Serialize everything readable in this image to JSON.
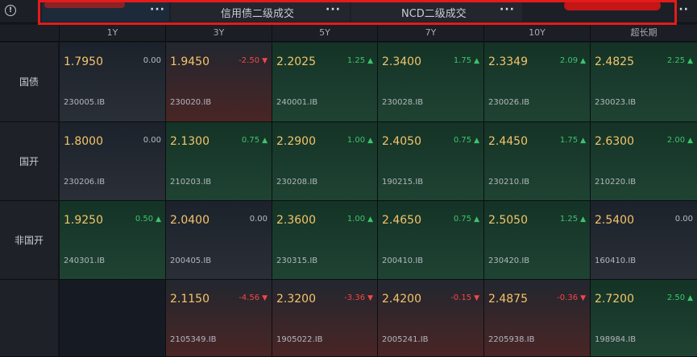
{
  "toolbar": {
    "tabs": [
      {
        "label": "",
        "more": "···"
      },
      {
        "label": "信用债二级成交",
        "more": "···"
      },
      {
        "label": "NCD二级成交",
        "more": "···"
      },
      {
        "label": "",
        "more": "···"
      }
    ]
  },
  "grid": {
    "columns": [
      "1Y",
      "3Y",
      "5Y",
      "7Y",
      "10Y",
      "超长期"
    ],
    "rows": [
      {
        "label": "国债",
        "cells": [
          {
            "price": "1.7950",
            "change": "0.00",
            "dir": "flat",
            "code": "230005.IB"
          },
          {
            "price": "1.9450",
            "change": "-2.50",
            "dir": "down",
            "code": "230020.IB"
          },
          {
            "price": "2.2025",
            "change": "1.25",
            "dir": "up",
            "code": "240001.IB"
          },
          {
            "price": "2.3400",
            "change": "1.75",
            "dir": "up",
            "code": "230028.IB"
          },
          {
            "price": "2.3349",
            "change": "2.09",
            "dir": "up",
            "code": "230026.IB"
          },
          {
            "price": "2.4825",
            "change": "2.25",
            "dir": "up",
            "code": "230023.IB"
          }
        ]
      },
      {
        "label": "国开",
        "cells": [
          {
            "price": "1.8000",
            "change": "0.00",
            "dir": "flat",
            "code": "230206.IB"
          },
          {
            "price": "2.1300",
            "change": "0.75",
            "dir": "up",
            "code": "210203.IB"
          },
          {
            "price": "2.2900",
            "change": "1.00",
            "dir": "up",
            "code": "230208.IB"
          },
          {
            "price": "2.4050",
            "change": "0.75",
            "dir": "up",
            "code": "190215.IB"
          },
          {
            "price": "2.4450",
            "change": "1.75",
            "dir": "up",
            "code": "230210.IB"
          },
          {
            "price": "2.6300",
            "change": "2.00",
            "dir": "up",
            "code": "210220.IB"
          }
        ]
      },
      {
        "label": "非国开",
        "cells": [
          {
            "price": "1.9250",
            "change": "0.50",
            "dir": "up",
            "code": "240301.IB"
          },
          {
            "price": "2.0400",
            "change": "0.00",
            "dir": "flat",
            "code": "200405.IB"
          },
          {
            "price": "2.3600",
            "change": "1.00",
            "dir": "up",
            "code": "230315.IB"
          },
          {
            "price": "2.4650",
            "change": "0.75",
            "dir": "up",
            "code": "200410.IB"
          },
          {
            "price": "2.5050",
            "change": "1.25",
            "dir": "up",
            "code": "230420.IB"
          },
          {
            "price": "2.5400",
            "change": "0.00",
            "dir": "flat",
            "code": "160410.IB"
          }
        ]
      },
      {
        "label": "",
        "cells": [
          {
            "price": "",
            "change": "",
            "dir": "empty",
            "code": ""
          },
          {
            "price": "2.1150",
            "change": "-4.56",
            "dir": "down",
            "code": "2105349.IB"
          },
          {
            "price": "2.3200",
            "change": "-3.36",
            "dir": "down",
            "code": "1905022.IB"
          },
          {
            "price": "2.4200",
            "change": "-0.15",
            "dir": "down",
            "code": "2005241.IB"
          },
          {
            "price": "2.4875",
            "change": "-0.36",
            "dir": "down",
            "code": "2205938.IB"
          },
          {
            "price": "2.7200",
            "change": "2.50",
            "dir": "up",
            "code": "198984.IB"
          }
        ]
      }
    ]
  },
  "colors": {
    "up": "#3ec46d",
    "down": "#f04848",
    "price": "#f4c46a",
    "annotation": "#e31b1b"
  },
  "icons": {
    "info": "info-circle-icon",
    "more": "more-dots-icon",
    "up": "triangle-up-icon",
    "down": "triangle-down-icon"
  }
}
